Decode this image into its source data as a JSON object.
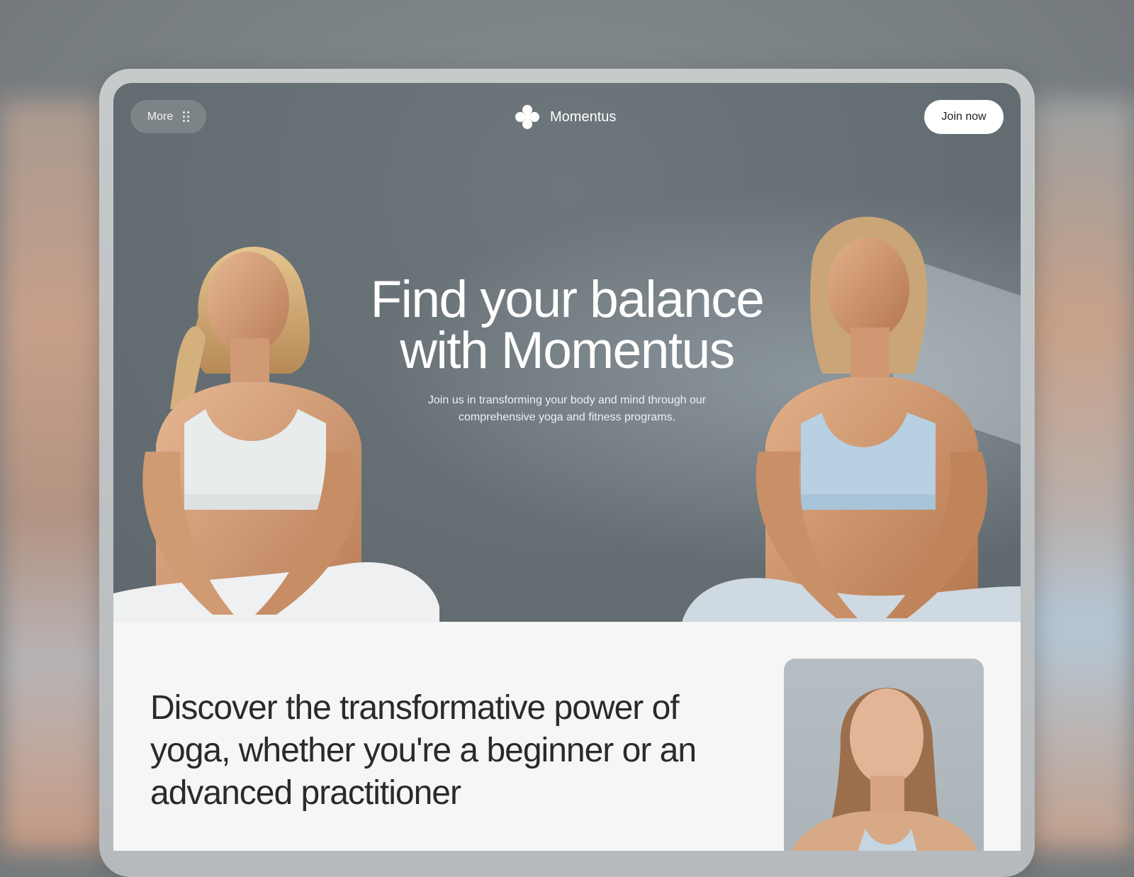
{
  "header": {
    "more_label": "More",
    "brand_name": "Momentus",
    "join_label": "Join now"
  },
  "hero": {
    "title_line1": "Find your balance",
    "title_line2": "with Momentus",
    "subtitle_line1": "Join us in transforming your body and mind through our",
    "subtitle_line2": "comprehensive yoga and fitness programs."
  },
  "about": {
    "line1": "Discover the transformative power of",
    "line2": "yoga, whether you're a beginner or an",
    "line3": "advanced practitioner"
  },
  "icons": {
    "menu": "grid-dots-icon",
    "logo": "flower-logo-icon"
  },
  "colors": {
    "hero_bg": "#666f74",
    "button_bg": "#ffffff",
    "page_bg": "#f6f6f6"
  }
}
